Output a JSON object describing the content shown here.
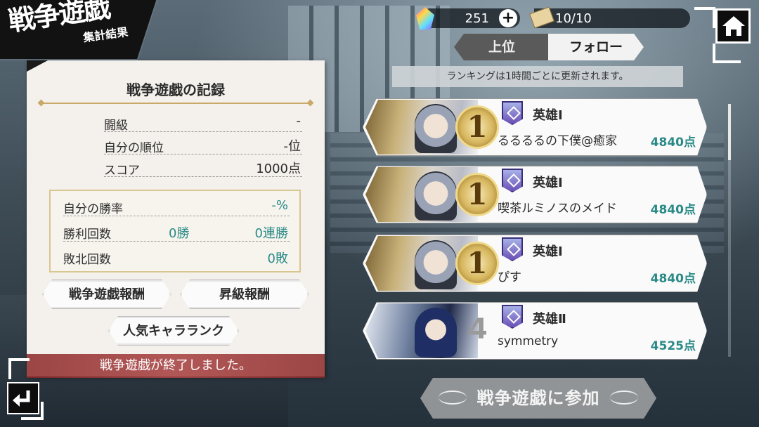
{
  "screen": {
    "title_main": "戦争遊戯",
    "title_sub": "集計結果"
  },
  "resources": {
    "gems": "251",
    "plus": "+",
    "tickets": "10/10"
  },
  "tabs": [
    {
      "label": "上位",
      "active": false
    },
    {
      "label": "フォロー",
      "active": true
    }
  ],
  "notice": "ランキングは1時間ごとに更新されます。",
  "record": {
    "title": "戦争遊戯の記録",
    "rows": [
      {
        "label": "闘級",
        "value": "-"
      },
      {
        "label": "自分の順位",
        "value": "-位"
      },
      {
        "label": "スコア",
        "value": "1000点"
      }
    ],
    "win_rate": {
      "label": "自分の勝率",
      "value": "-%"
    },
    "wins": {
      "label": "勝利回数",
      "count": "0勝",
      "streak": "0連勝"
    },
    "losses": {
      "label": "敗北回数",
      "count": "0敗"
    }
  },
  "buttons": {
    "reward": "戦争遊戯報酬",
    "promotion_reward": "昇級報酬",
    "popular_chara": "人気キャラランク",
    "join": "戦争遊戯に参加"
  },
  "end_banner": "戦争遊戯が終了しました。",
  "ranking": [
    {
      "rank": "1",
      "title": "英雄Ⅰ",
      "name": "るるるるの下僕@癒家",
      "points": "4840点",
      "medal": true
    },
    {
      "rank": "1",
      "title": "英雄Ⅰ",
      "name": "喫茶ルミノスのメイド",
      "points": "4840点",
      "medal": true
    },
    {
      "rank": "1",
      "title": "英雄Ⅰ",
      "name": "ぴす",
      "points": "4840点",
      "medal": true
    },
    {
      "rank": "4",
      "title": "英雄Ⅱ",
      "name": "symmetry",
      "points": "4525点",
      "medal": false
    }
  ],
  "colors": {
    "accent_teal": "#2a8a87",
    "gold": "#c9a86a",
    "banner_red": "#9a3a3a"
  }
}
